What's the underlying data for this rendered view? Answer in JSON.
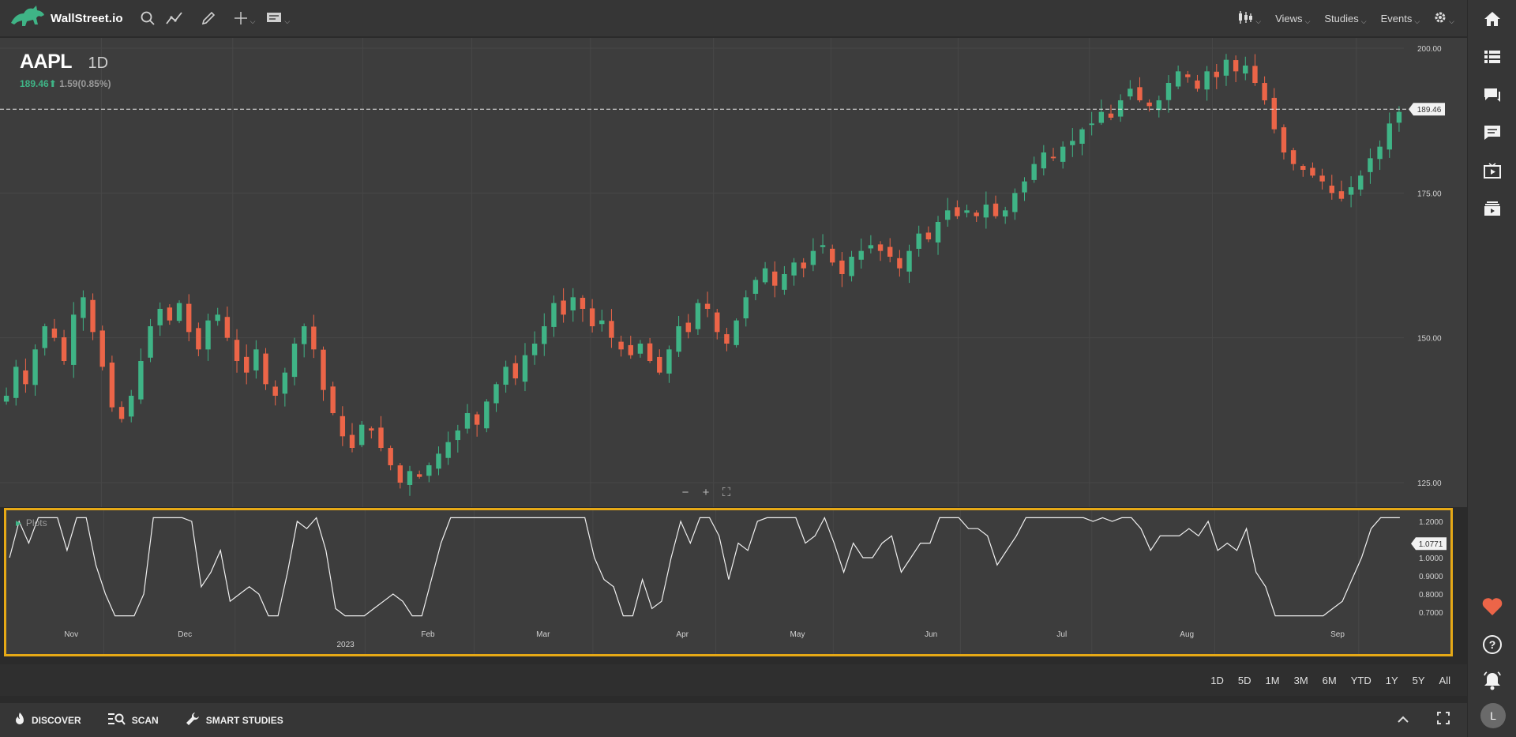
{
  "app": {
    "name": "WallStreet.io"
  },
  "toolbar": {
    "menus": {
      "views": "Views",
      "studies": "Studies",
      "events": "Events"
    }
  },
  "chart": {
    "symbol": "AAPL",
    "interval": "1D",
    "last_price": "189.46",
    "change": "1.59(0.85%)",
    "current_price_label": "189.46",
    "y_ticks": [
      "200.00",
      "175.00",
      "150.00",
      "125.00"
    ],
    "x_ticks": [
      "Nov",
      "Dec",
      "Feb",
      "Mar",
      "Apr",
      "May",
      "Jun",
      "Jul",
      "Aug",
      "Sep"
    ],
    "year_label": "2023",
    "colors": {
      "up": "#3fb486",
      "down": "#ec6548",
      "background": "#3d3d3d",
      "highlight": "#e6a916"
    }
  },
  "study": {
    "label": "Plots",
    "y_ticks": [
      "1.2000",
      "1.0000",
      "0.9000",
      "0.8000",
      "0.7000"
    ],
    "current_value_label": "1.0771"
  },
  "chart_data": {
    "type": "candlestick",
    "price_axis": {
      "ylim": [
        123,
        208
      ],
      "ticks": [
        125,
        150,
        175,
        200
      ]
    },
    "study_axis": {
      "ylim": [
        0.65,
        1.23
      ],
      "ticks": [
        0.7,
        0.8,
        0.9,
        1.0,
        1.2
      ]
    },
    "current_price": 189.46,
    "current_study_value": 1.0771,
    "x_labels": [
      "Nov",
      "Dec",
      "2023",
      "Feb",
      "Mar",
      "Apr",
      "May",
      "Jun",
      "Jul",
      "Aug",
      "Sep"
    ],
    "closes": [
      140,
      145,
      142,
      148,
      152,
      150,
      146,
      154,
      157,
      151,
      145,
      138,
      136,
      140,
      146,
      152,
      155,
      153,
      156,
      151,
      148,
      153,
      154,
      150,
      146,
      144,
      148,
      142,
      140,
      144,
      149,
      152,
      148,
      141,
      137,
      133,
      131,
      135,
      134,
      131,
      128,
      125,
      127,
      126,
      128,
      130,
      132,
      134,
      137,
      135,
      139,
      142,
      145,
      143,
      147,
      149,
      152,
      156,
      154,
      157,
      155,
      152,
      153,
      150,
      148,
      147,
      149,
      146,
      144,
      148,
      152,
      151,
      156,
      155,
      151,
      149,
      153,
      157,
      160,
      162,
      159,
      161,
      163,
      162,
      165,
      166,
      163,
      161,
      164,
      165,
      166,
      165,
      164,
      162,
      165,
      168,
      167,
      170,
      172,
      171,
      172,
      171,
      173,
      171,
      172,
      175,
      177,
      180,
      182,
      181,
      183,
      184,
      186,
      187,
      189,
      188,
      191,
      193,
      191,
      190,
      191,
      194,
      196,
      195,
      193,
      196,
      195,
      198,
      196,
      197,
      194,
      191,
      186,
      182,
      180,
      179,
      178,
      177,
      175,
      174,
      176,
      178,
      181,
      183,
      187,
      189
    ]
  },
  "range_buttons": [
    "1D",
    "5D",
    "1M",
    "3M",
    "6M",
    "YTD",
    "1Y",
    "5Y",
    "All"
  ],
  "bottom_bar": {
    "discover": "DISCOVER",
    "scan": "SCAN",
    "smart_studies": "SMART STUDIES"
  },
  "user": {
    "avatar_initial": "L"
  }
}
